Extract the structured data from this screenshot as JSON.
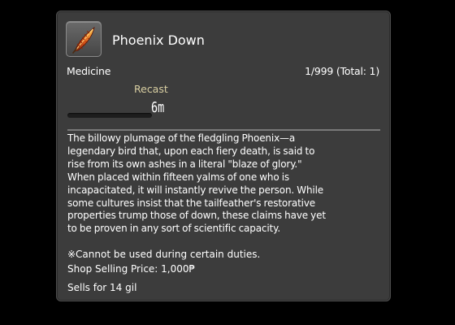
{
  "item": {
    "name": "Phoenix Down",
    "icon": "phoenix-feather-icon",
    "category": "Medicine",
    "stack": "1/999 (Total: 1)"
  },
  "recast": {
    "label": "Recast",
    "time": "6m",
    "progress_fraction": 0
  },
  "description": {
    "lines": [
      "The billowy plumage of the fledgling Phoenix—a",
      "legendary bird that, upon each fiery death, is said to",
      "rise from its own ashes in a literal \"blaze of glory.\"",
      "When placed within fifteen yalms of one who is",
      "incapacitated, it will instantly revive the person. While",
      "some cultures insist that the tailfeather's restorative",
      "properties trump those of down, these claims have yet",
      "to be proven in any sort of scientific capacity."
    ]
  },
  "note": "※Cannot be used during certain duties.",
  "shop_price": "Shop Selling Price: 1,000₱",
  "sells_for": "Sells for 14 gil",
  "colors": {
    "panel_bg": "#3c3c3c",
    "recast_label": "#d9cfa2",
    "text": "#ffffff"
  }
}
